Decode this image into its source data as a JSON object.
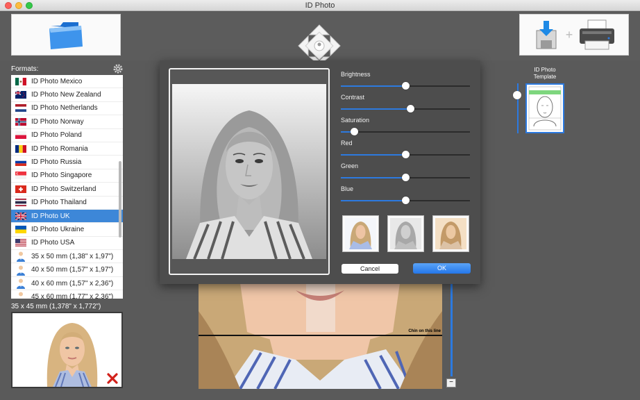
{
  "window": {
    "title": "ID Photo"
  },
  "sidebar": {
    "formats_label": "Formats:",
    "items": [
      {
        "label": "ID Photo Mexico",
        "icon": "flag-mexico-icon",
        "selected": false
      },
      {
        "label": "ID Photo New Zealand",
        "icon": "flag-new-zealand-icon",
        "selected": false
      },
      {
        "label": "ID Photo Netherlands",
        "icon": "flag-netherlands-icon",
        "selected": false
      },
      {
        "label": "ID Photo Norway",
        "icon": "flag-norway-icon",
        "selected": false
      },
      {
        "label": "ID Photo Poland",
        "icon": "flag-poland-icon",
        "selected": false
      },
      {
        "label": "ID Photo Romania",
        "icon": "flag-romania-icon",
        "selected": false
      },
      {
        "label": "ID Photo Russia",
        "icon": "flag-russia-icon",
        "selected": false
      },
      {
        "label": "ID Photo Singapore",
        "icon": "flag-singapore-icon",
        "selected": false
      },
      {
        "label": "ID Photo Switzerland",
        "icon": "flag-switzerland-icon",
        "selected": false
      },
      {
        "label": "ID Photo Thailand",
        "icon": "flag-thailand-icon",
        "selected": false
      },
      {
        "label": "ID Photo UK",
        "icon": "flag-uk-icon",
        "selected": true
      },
      {
        "label": "ID Photo Ukraine",
        "icon": "flag-ukraine-icon",
        "selected": false
      },
      {
        "label": "ID Photo USA",
        "icon": "flag-usa-icon",
        "selected": false
      },
      {
        "label": "35 x 50 mm (1,38\" x 1,97\")",
        "icon": "person-icon",
        "selected": false
      },
      {
        "label": "40 x 50 mm (1,57\" x 1,97\")",
        "icon": "person-icon",
        "selected": false
      },
      {
        "label": "40 x 60 mm (1,57\" x 2,36\")",
        "icon": "person-icon",
        "selected": false
      },
      {
        "label": "45 x 60 mm (1,77\" x 2,36\")",
        "icon": "person-icon",
        "selected": false
      }
    ],
    "selected_size": "35 x 45 mm (1,378\" x 1,772\")"
  },
  "canvas": {
    "chin_label": "Chin on this line"
  },
  "template": {
    "label_line1": "ID Photo",
    "label_line2": "Template"
  },
  "adjust_dialog": {
    "sliders": [
      {
        "label": "Brightness",
        "value": 0.5
      },
      {
        "label": "Contrast",
        "value": 0.54
      },
      {
        "label": "Saturation",
        "value": 0.1
      },
      {
        "label": "Red",
        "value": 0.5
      },
      {
        "label": "Green",
        "value": 0.5
      },
      {
        "label": "Blue",
        "value": 0.5
      }
    ],
    "presets": [
      "color-preset",
      "grayscale-preset",
      "sepia-preset"
    ],
    "cancel_label": "Cancel",
    "ok_label": "OK"
  },
  "colors": {
    "accent": "#2c7ae0",
    "selected": "#3d87d8"
  }
}
